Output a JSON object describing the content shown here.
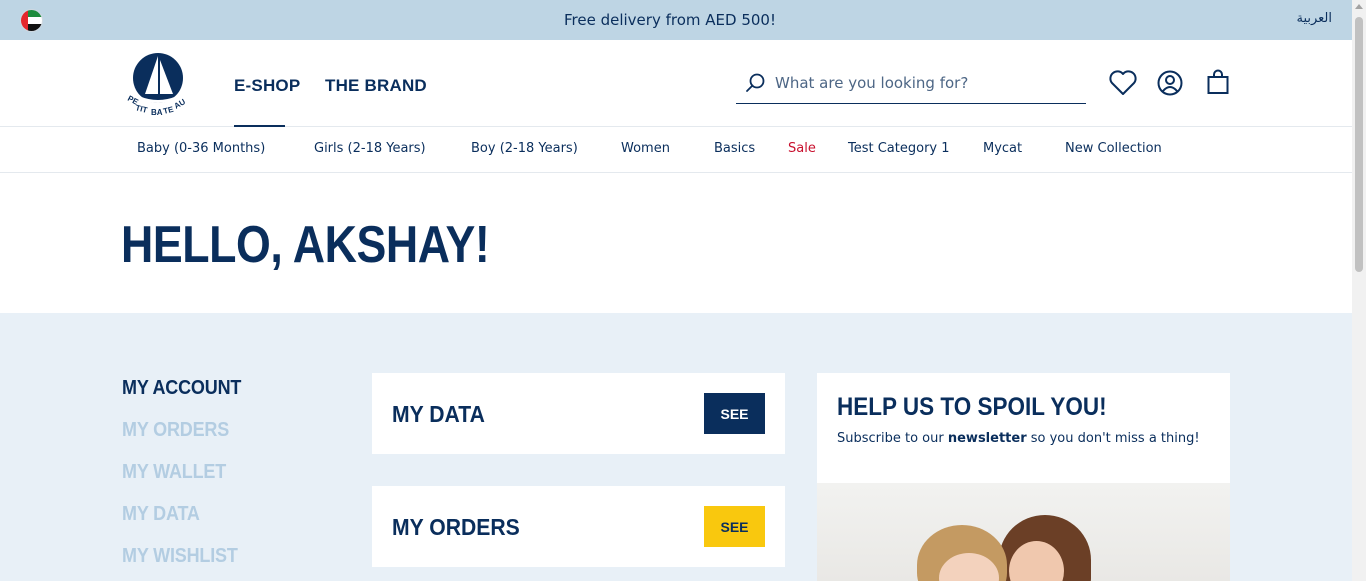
{
  "topbar": {
    "promo": "Free delivery from AED 500!",
    "language": "العربية"
  },
  "header": {
    "logo_text": "PETIT BATEAU",
    "nav": [
      "E-SHOP",
      "THE BRAND"
    ],
    "search_placeholder": "What are you looking for?"
  },
  "categories": [
    "Baby (0-36 Months)",
    "Girls (2-18 Years)",
    "Boy (2-18 Years)",
    "Women",
    "Basics",
    "Sale",
    "Test Category 1",
    "Mycat",
    "New Collection"
  ],
  "greeting": "HELLO, AKSHAY!",
  "sidebar": {
    "items": [
      "MY ACCOUNT",
      "MY ORDERS",
      "MY WALLET",
      "MY DATA",
      "MY WISHLIST"
    ]
  },
  "cards": [
    {
      "title": "MY DATA",
      "button": "SEE"
    },
    {
      "title": "MY ORDERS",
      "button": "SEE"
    }
  ],
  "newsletter": {
    "title": "HELP US TO SPOIL YOU!",
    "text_before": "Subscribe to our ",
    "text_bold": "newsletter",
    "text_after": " so you don't miss a thing!"
  },
  "colors": {
    "navy": "#0a2e5c",
    "topbar": "#bed5e4",
    "content_bg": "#e8f0f7",
    "sale_red": "#c8102e",
    "see_yellow": "#f9c80e",
    "sidebar_inactive": "#b3cde2"
  }
}
